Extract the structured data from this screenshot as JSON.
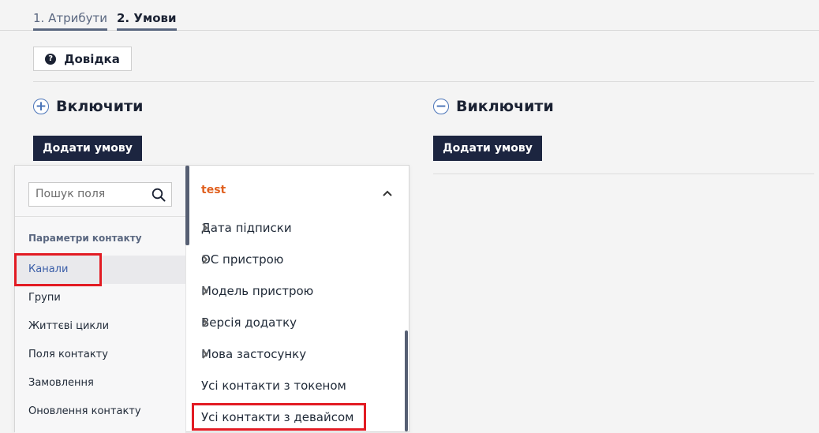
{
  "tabs": [
    {
      "num": "1.",
      "label": "Атрибути"
    },
    {
      "num": "2.",
      "label": "Умови"
    }
  ],
  "help_button": {
    "label": "Довідка",
    "icon": "question-circle-icon"
  },
  "include": {
    "title": "Включити",
    "icon": "plus-circle-icon",
    "add_button": "Додати умову"
  },
  "exclude": {
    "title": "Виключити",
    "icon": "minus-circle-icon",
    "add_button": "Додати умову"
  },
  "field_picker": {
    "search_placeholder": "Пошук поля",
    "group_label": "Параметри контакту",
    "left_items": [
      {
        "label": "Канали",
        "active": true
      },
      {
        "label": "Групи"
      },
      {
        "label": "Життєві цикли"
      },
      {
        "label": "Поля контакту"
      },
      {
        "label": "Замовлення"
      },
      {
        "label": "Оновлення контакту"
      }
    ],
    "right_header": "test",
    "right_items": [
      {
        "label": "Дата підписки",
        "has_submenu": true
      },
      {
        "label": "ОС пристрою",
        "has_submenu": true
      },
      {
        "label": "Модель пристрою",
        "has_submenu": true
      },
      {
        "label": "Версія додатку",
        "has_submenu": true
      },
      {
        "label": "Мова застосунку",
        "has_submenu": true
      },
      {
        "label": "Усі контакти з токеном",
        "has_submenu": false
      },
      {
        "label": "Усі контакти з девайсом",
        "has_submenu": false
      }
    ]
  },
  "colors": {
    "accent": "#1c2540",
    "highlight": "#e21b23",
    "group_header": "#e0601f",
    "link": "#3b5ea8"
  }
}
